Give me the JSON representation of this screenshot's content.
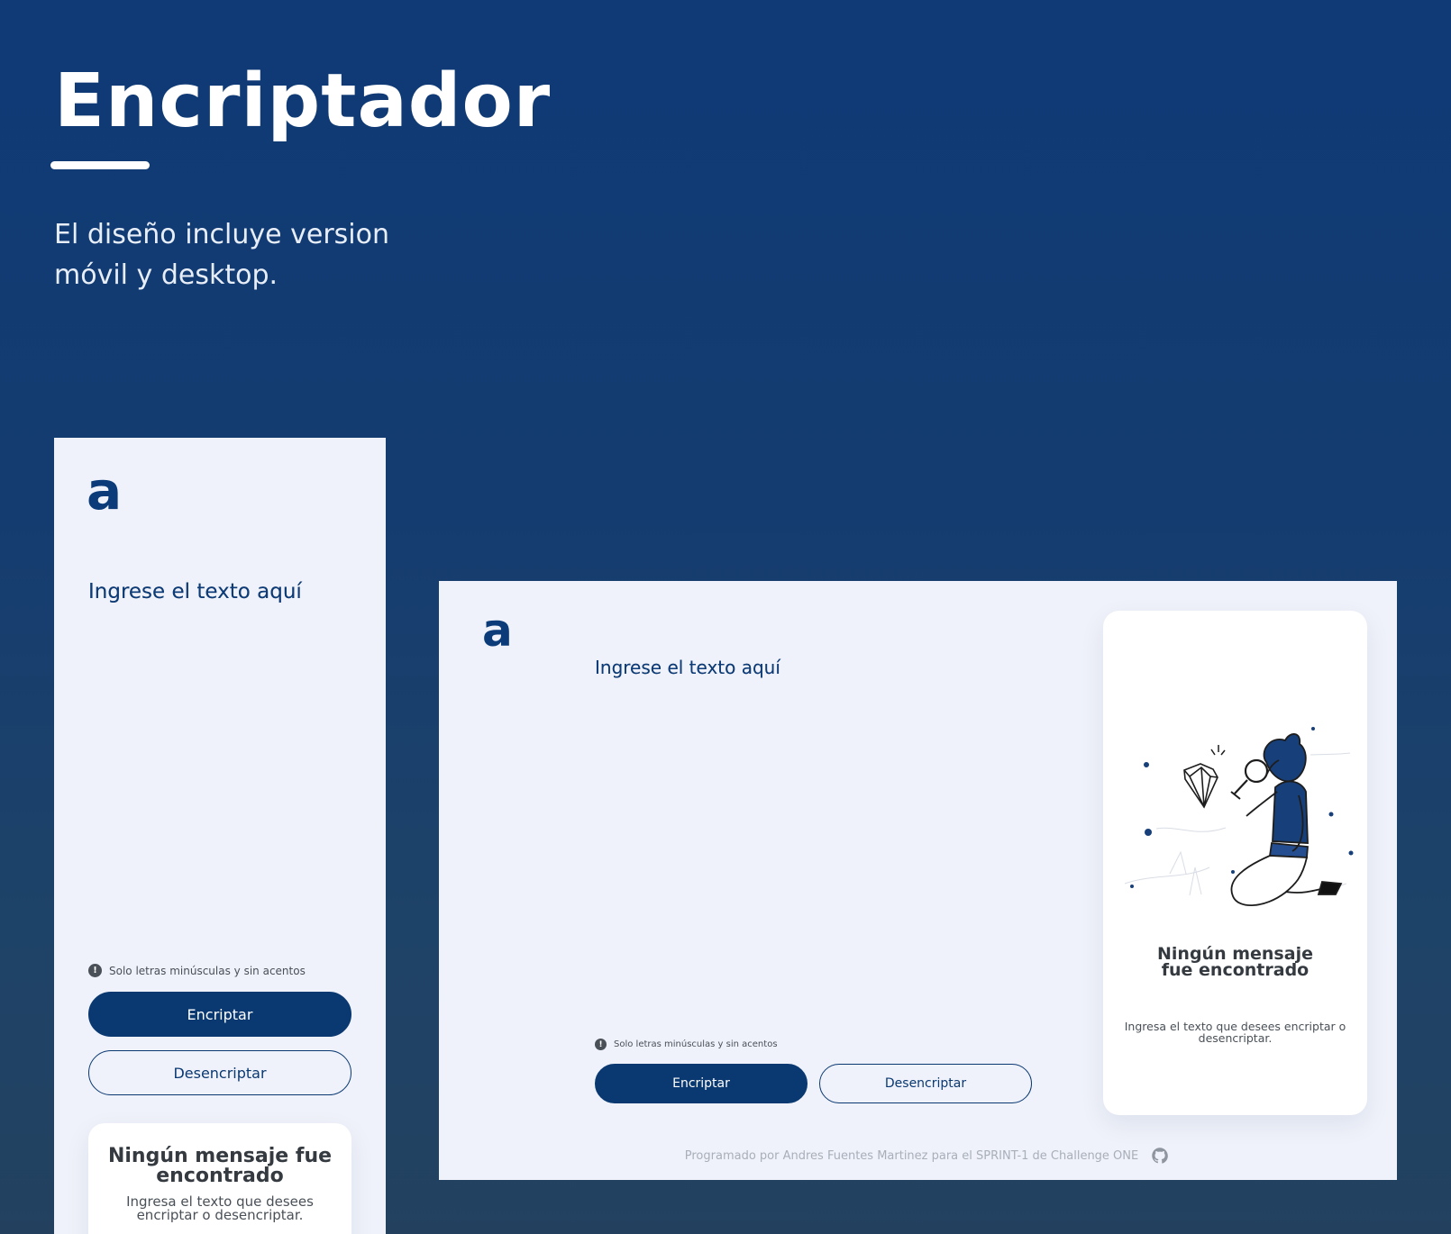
{
  "hero": {
    "title": "Encriptador",
    "subtitle": "El diseño incluye version móvil y desktop."
  },
  "colors": {
    "background": "#123b71",
    "primary": "#0a3871",
    "screen_bg": "#eff2fa",
    "card_bg": "#ffffff",
    "muted_text": "#a8afb9"
  },
  "mobile": {
    "logo": "a",
    "placeholder": "Ingrese el texto aquí",
    "hint": "Solo letras minúsculas y sin acentos",
    "hint_icon": "exclamation-circle-icon",
    "encrypt_label": "Encriptar",
    "decrypt_label": "Desencriptar",
    "card_title": "Ningún mensaje fue encontrado",
    "card_text": "Ingresa el texto que desees encriptar o desencriptar."
  },
  "desktop": {
    "logo": "a",
    "placeholder": "Ingrese el texto aquí",
    "hint": "Solo letras minúsculas y sin acentos",
    "hint_icon": "exclamation-circle-icon",
    "encrypt_label": "Encriptar",
    "decrypt_label": "Desencriptar",
    "illustration": "person-with-magnifier-illustration",
    "card_title": "Ningún mensaje fue encontrado",
    "card_text": "Ingresa el texto que desees encriptar o desencriptar.",
    "footer_text": "Programado por Andres Fuentes Martinez para el SPRINT-1 de Challenge ONE",
    "footer_icon": "github-icon"
  }
}
